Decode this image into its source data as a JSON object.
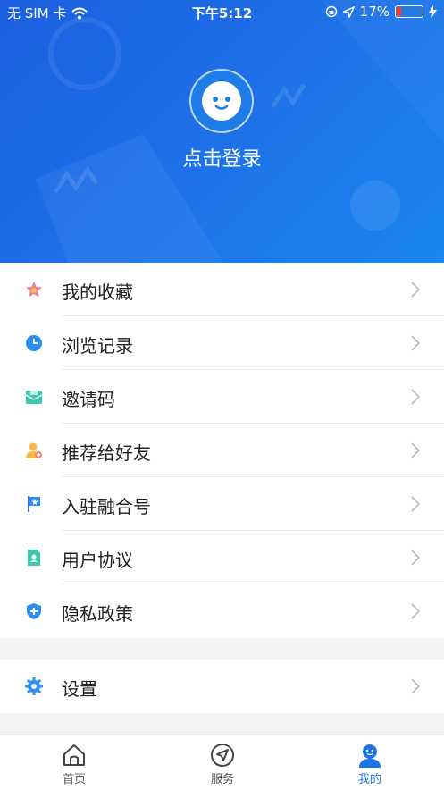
{
  "status_bar": {
    "carrier": "无 SIM 卡",
    "time": "下午5:12",
    "battery": "17%"
  },
  "profile": {
    "login_text": "点击登录"
  },
  "menu": [
    {
      "label": "我的收藏",
      "icon": "star-icon"
    },
    {
      "label": "浏览记录",
      "icon": "clock-icon"
    },
    {
      "label": "邀请码",
      "icon": "envelope-icon"
    },
    {
      "label": "推荐给好友",
      "icon": "user-add-icon"
    },
    {
      "label": "入驻融合号",
      "icon": "flag-icon"
    },
    {
      "label": "用户协议",
      "icon": "document-user-icon"
    },
    {
      "label": "隐私政策",
      "icon": "shield-plus-icon"
    }
  ],
  "settings": {
    "label": "设置",
    "icon": "gear-icon"
  },
  "tabbar": [
    {
      "label": "首页",
      "icon": "home-icon",
      "active": false
    },
    {
      "label": "服务",
      "icon": "compass-icon",
      "active": false
    },
    {
      "label": "我的",
      "icon": "profile-icon",
      "active": true
    }
  ],
  "colors": {
    "hero_start": "#1b5fe0",
    "hero_end": "#1a86f0",
    "accent": "#1a73e8"
  }
}
